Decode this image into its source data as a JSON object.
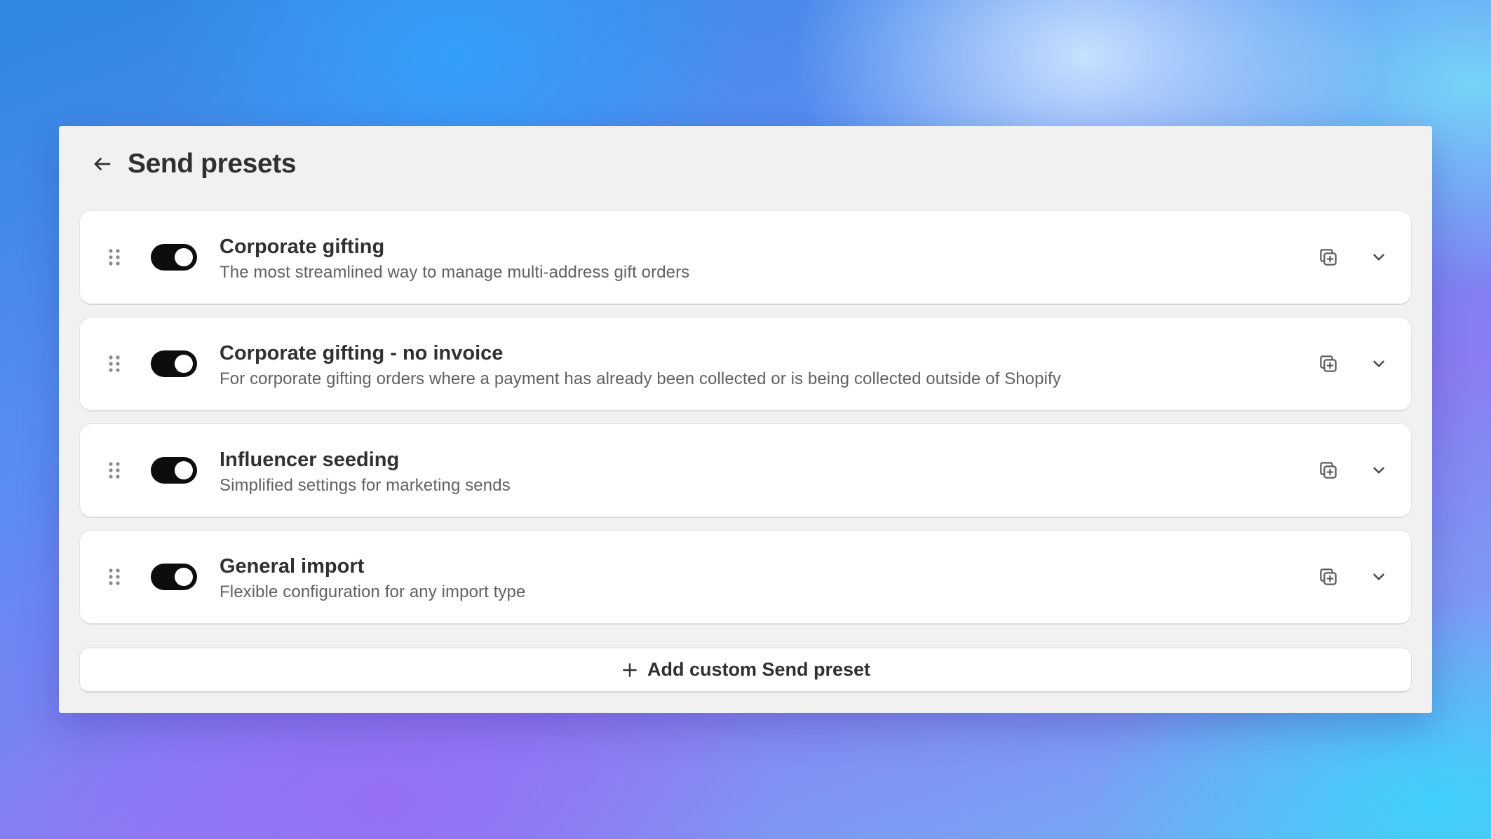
{
  "page": {
    "title": "Send presets"
  },
  "presets": [
    {
      "title": "Corporate gifting",
      "description": "The most streamlined way to manage multi-address gift orders",
      "enabled": true
    },
    {
      "title": "Corporate gifting - no invoice",
      "description": "For corporate gifting orders where a payment has already been collected or is being collected outside of Shopify",
      "enabled": true
    },
    {
      "title": "Influencer seeding",
      "description": "Simplified settings for marketing sends",
      "enabled": true
    },
    {
      "title": "General import",
      "description": "Flexible configuration for any import type",
      "enabled": true
    }
  ],
  "add_button": {
    "label": "Add custom Send preset"
  },
  "icons": {
    "back": "arrow-left-icon",
    "drag": "drag-handle-icon",
    "duplicate": "duplicate-icon",
    "expand": "chevron-down-icon",
    "add": "plus-icon"
  },
  "colors": {
    "toggle_on": "#0d0d0d",
    "panel_bg": "#f1f1f1",
    "text_primary": "#303030",
    "text_secondary": "#616161"
  }
}
